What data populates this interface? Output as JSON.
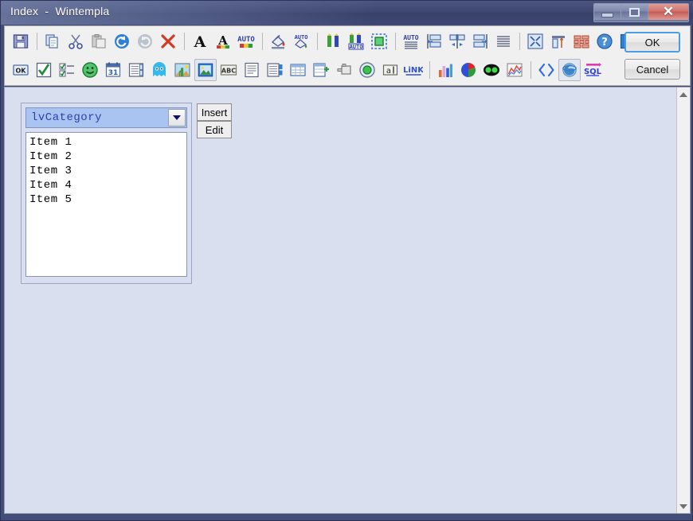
{
  "window": {
    "title": "Index  -  Wintempla",
    "controls": {
      "minimize": "minimize",
      "maximize": "maximize",
      "close": "✕"
    }
  },
  "dialog_buttons": {
    "ok_label": "OK",
    "cancel_label": "Cancel"
  },
  "toolbar": {
    "row1": [
      {
        "name": "save-icon",
        "tip": "Save"
      },
      {
        "name": "separator",
        "tip": ""
      },
      {
        "name": "copy-icon",
        "tip": "Copy"
      },
      {
        "name": "cut-icon",
        "tip": "Cut"
      },
      {
        "name": "paste-icon",
        "tip": "Paste"
      },
      {
        "name": "undo-icon",
        "tip": "Undo"
      },
      {
        "name": "redo-icon",
        "tip": "Redo"
      },
      {
        "name": "delete-icon",
        "tip": "Delete"
      },
      {
        "name": "separator",
        "tip": ""
      },
      {
        "name": "font-icon",
        "tip": "Font"
      },
      {
        "name": "font-color-icon",
        "tip": "Font Color"
      },
      {
        "name": "auto-font-color-icon",
        "tip": "Auto Font Color"
      },
      {
        "name": "separator",
        "tip": ""
      },
      {
        "name": "fill-color-icon",
        "tip": "Fill Color"
      },
      {
        "name": "auto-fill-color-icon",
        "tip": "Auto Fill Color"
      },
      {
        "name": "separator",
        "tip": ""
      },
      {
        "name": "border-pencil-icon",
        "tip": "Border Color"
      },
      {
        "name": "auto-border-pencil-icon",
        "tip": "Auto Border Color"
      },
      {
        "name": "selection-box-icon",
        "tip": "Selection"
      },
      {
        "name": "separator",
        "tip": ""
      },
      {
        "name": "auto-size-icon",
        "tip": "Auto Size"
      },
      {
        "name": "align-left-icon",
        "tip": "Align Left"
      },
      {
        "name": "align-center-icon",
        "tip": "Align Center"
      },
      {
        "name": "align-right-icon",
        "tip": "Align Right"
      },
      {
        "name": "justify-icon",
        "tip": "Justify"
      },
      {
        "name": "separator",
        "tip": ""
      },
      {
        "name": "resize-icon",
        "tip": "Resize"
      },
      {
        "name": "dock-top-icon",
        "tip": "Dock Top"
      },
      {
        "name": "grid-layout-icon",
        "tip": "Grid Layout"
      },
      {
        "name": "help-icon",
        "tip": "Help"
      },
      {
        "name": "info-icon",
        "tip": "Information"
      }
    ],
    "row2": [
      {
        "name": "button-ok-icon",
        "tip": "Button"
      },
      {
        "name": "checkbox-icon",
        "tip": "Check Box"
      },
      {
        "name": "checked-listbox-icon",
        "tip": "Checked List Box"
      },
      {
        "name": "smiley-icon",
        "tip": "Emoji"
      },
      {
        "name": "calendar-icon",
        "tip": "Calendar"
      },
      {
        "name": "spinner-list-icon",
        "tip": "Spin List"
      },
      {
        "name": "ghost-icon",
        "tip": "Sprite"
      },
      {
        "name": "image-cactus-icon",
        "tip": "Image"
      },
      {
        "name": "picture-box-icon",
        "tip": "Picture Box"
      },
      {
        "name": "abc-label-icon",
        "tip": "Label"
      },
      {
        "name": "text-block-icon",
        "tip": "Text Block"
      },
      {
        "name": "listview-spin-icon",
        "tip": "List View"
      },
      {
        "name": "table-grid-icon",
        "tip": "Data Grid"
      },
      {
        "name": "tree-add-icon",
        "tip": "Tree View"
      },
      {
        "name": "tool-icon",
        "tip": "Tool"
      },
      {
        "name": "radio-green-icon",
        "tip": "Radio Button"
      },
      {
        "name": "textbox-a-icon",
        "tip": "Text Box"
      },
      {
        "name": "link-icon",
        "tip": "Link"
      },
      {
        "name": "separator",
        "tip": ""
      },
      {
        "name": "bar-chart-icon",
        "tip": "Bar Chart"
      },
      {
        "name": "pie-chart-icon",
        "tip": "Pie Chart"
      },
      {
        "name": "goggles-icon",
        "tip": "3D View"
      },
      {
        "name": "line-chart-icon",
        "tip": "Line Chart"
      },
      {
        "name": "separator",
        "tip": ""
      },
      {
        "name": "code-brackets-icon",
        "tip": "Code"
      },
      {
        "name": "browser-e-icon",
        "tip": "Web Browser"
      },
      {
        "name": "sql-icon",
        "tip": "SQL"
      }
    ]
  },
  "main": {
    "combo": {
      "value": "lvCategory",
      "arrow_icon": "chevron-down-icon"
    },
    "list_items": [
      "Item 1",
      "Item 2",
      "Item 3",
      "Item 4",
      "Item 5"
    ],
    "insert_label": "Insert",
    "edit_label": "Edit"
  },
  "scrollbar": {
    "up_icon": "triangle-up-icon",
    "down_icon": "triangle-down-icon"
  },
  "colors": {
    "title_bar": "#3c4670",
    "client_bg": "#d9dfee",
    "toolbar_bg": "#f0f0f0",
    "combo_bg": "#a9c4f0",
    "combo_text": "#2f3fa8",
    "focus_border": "#4a9de0"
  }
}
